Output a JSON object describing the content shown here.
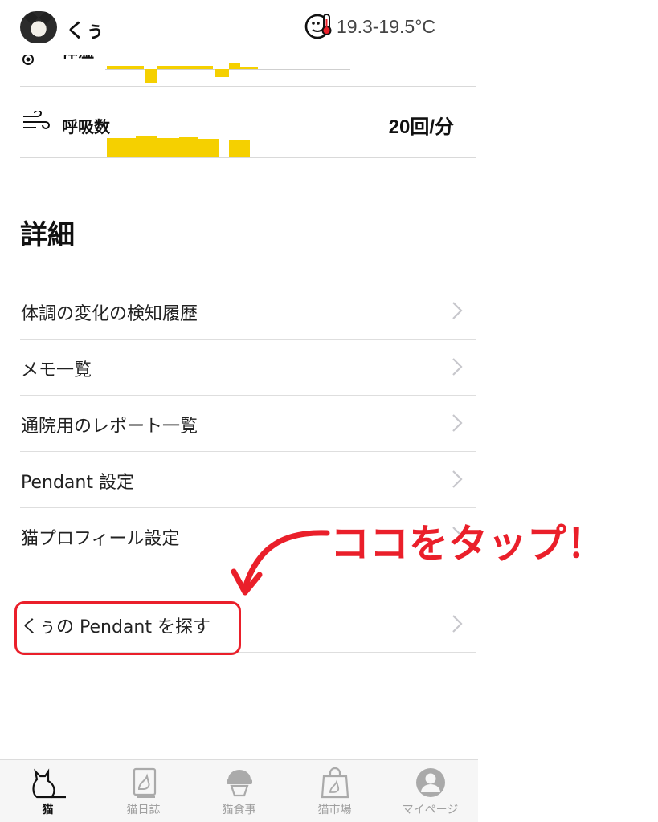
{
  "header": {
    "cat_name": "くぅ",
    "temperature_range": "19.3-19.5°C",
    "sensor_icon": "room-thermometer-icon",
    "avatar_icon": "cat-avatar"
  },
  "vitals": [
    {
      "label": "体温",
      "value": "",
      "icon": "target-icon"
    },
    {
      "label": "呼吸数",
      "value": "20回/分",
      "icon": "wind-icon"
    }
  ],
  "section": {
    "title": "詳細"
  },
  "menu": [
    {
      "label": "体調の変化の検知履歴"
    },
    {
      "label": "メモ一覧"
    },
    {
      "label": "通院用のレポート一覧"
    },
    {
      "label": "Pendant 設定"
    },
    {
      "label": "猫プロフィール設定"
    },
    {
      "label": "くぅの Pendant を探す"
    }
  ],
  "annotation": {
    "text": "ココをタップ！",
    "color": "#ea1f2a"
  },
  "tabs": [
    {
      "label": "猫",
      "icon": "cat-icon",
      "active": true
    },
    {
      "label": "猫日誌",
      "icon": "diary-icon",
      "active": false
    },
    {
      "label": "猫食事",
      "icon": "food-bowl-icon",
      "active": false
    },
    {
      "label": "猫市場",
      "icon": "shopping-bag-icon",
      "active": false
    },
    {
      "label": "マイページ",
      "icon": "user-icon",
      "active": false
    }
  ],
  "colors": {
    "accent": "#f5d000",
    "highlight": "#ea1f2a"
  }
}
